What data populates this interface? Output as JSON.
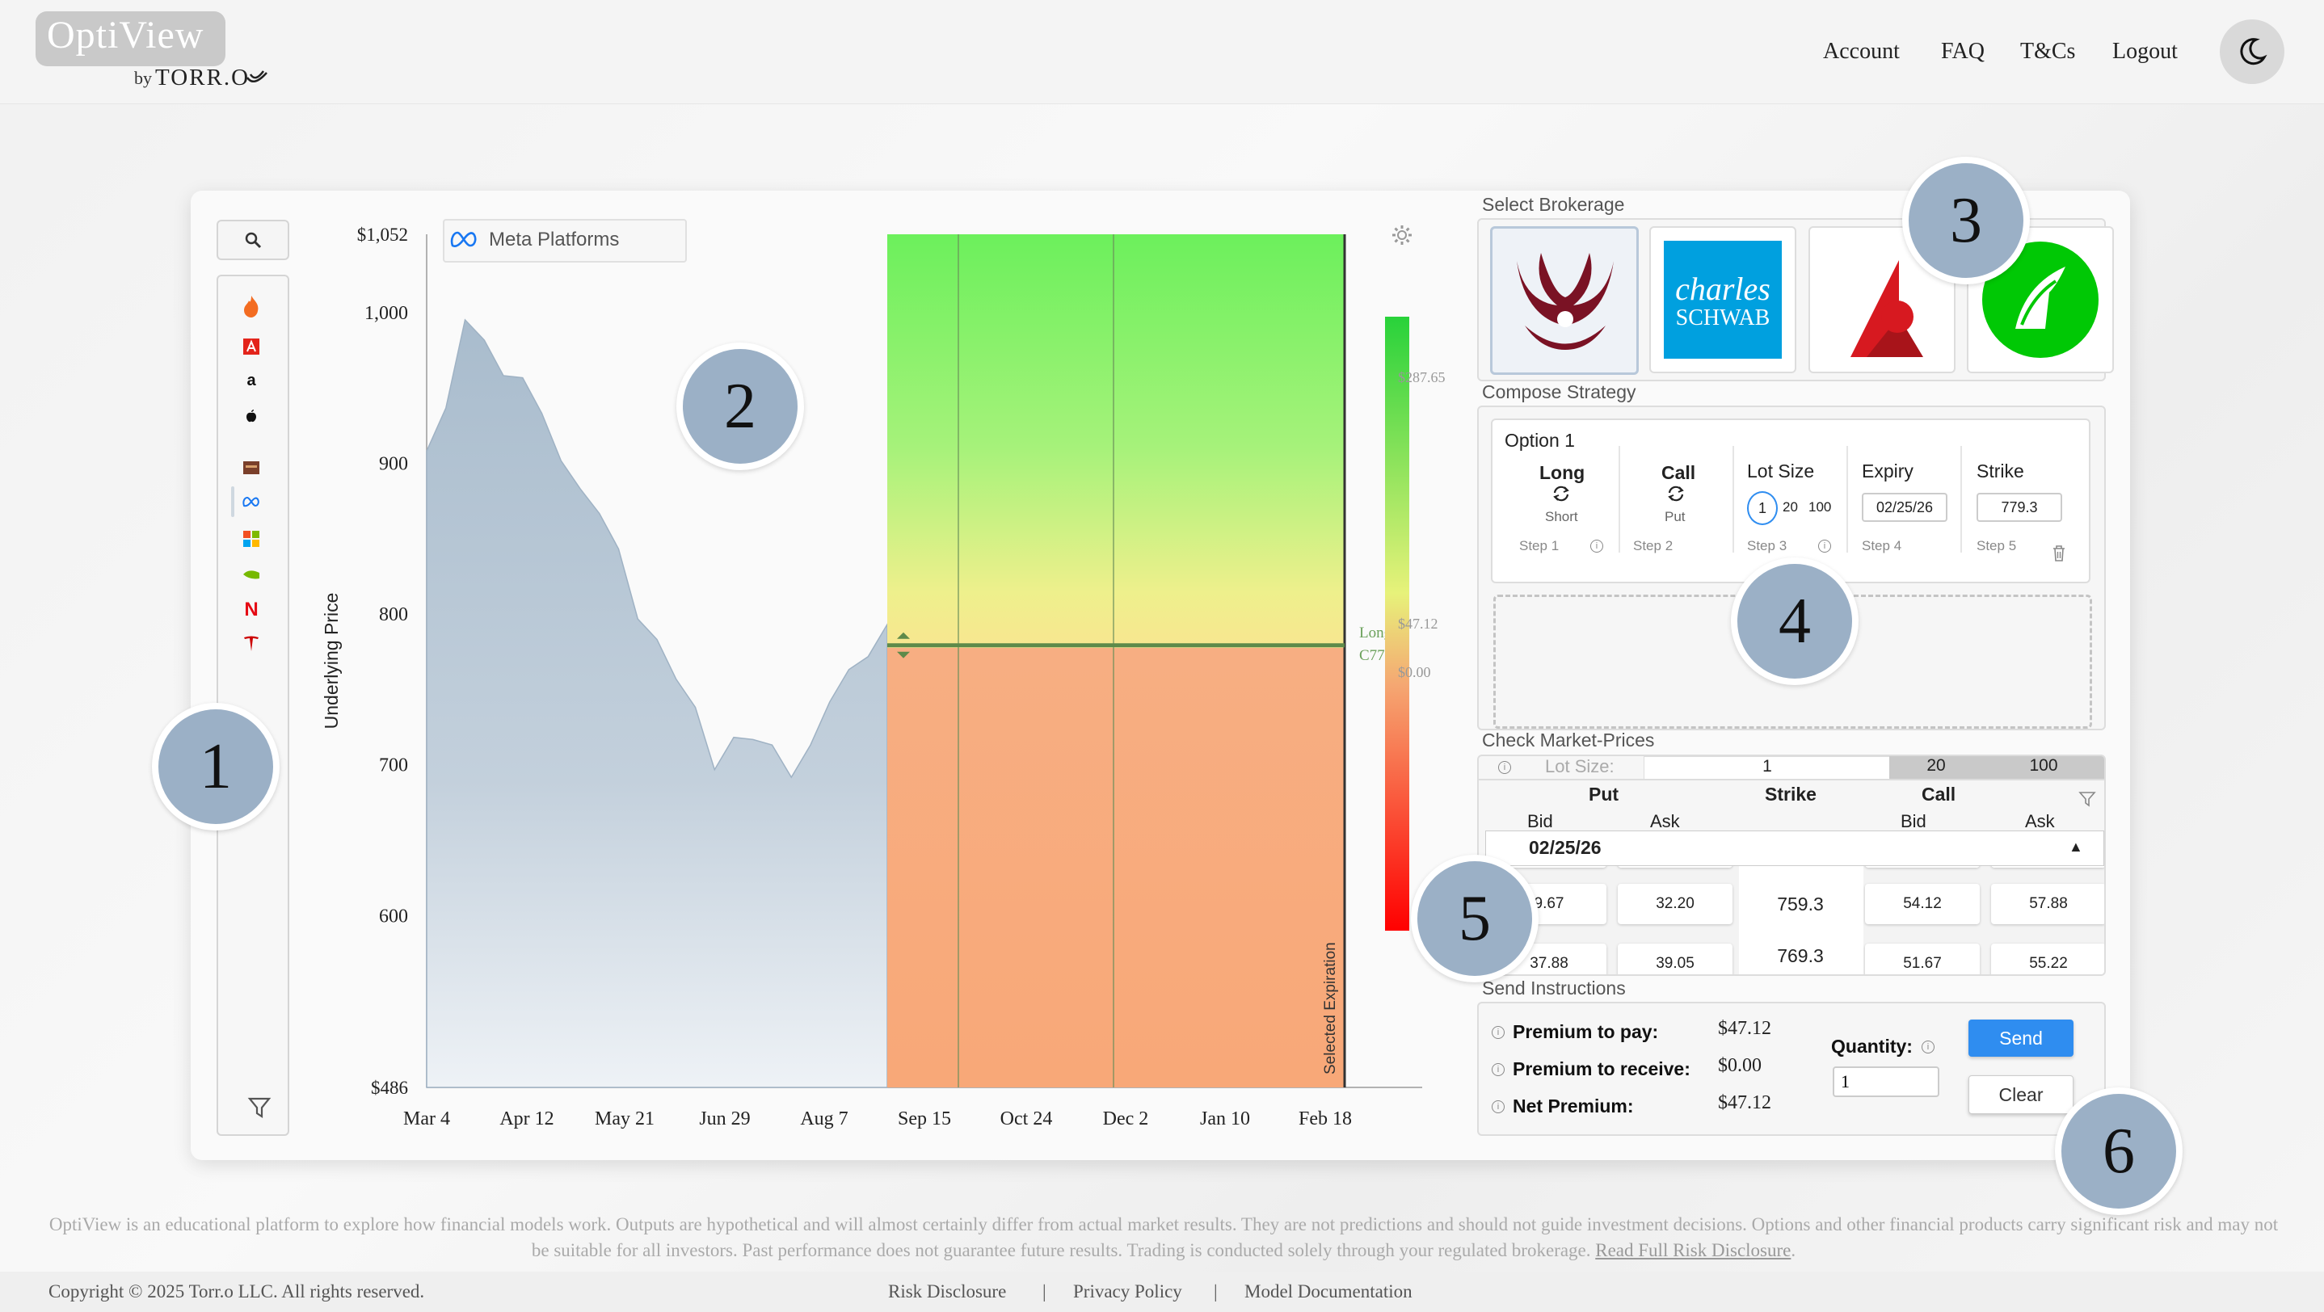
{
  "header": {
    "logo": "OptiView",
    "logo_by": "by",
    "logo_brand": "TORR.O",
    "nav": [
      "Account",
      "FAQ",
      "T&Cs",
      "Logout"
    ],
    "theme_icon": "moon-icon"
  },
  "chart": {
    "ticker": "Meta Platforms",
    "ylabel": "Underlying Price",
    "y_top_label": "$1,052",
    "y_bottom_label": "$486",
    "y_ticks": [
      "1,000",
      "900",
      "800",
      "700",
      "600"
    ],
    "x_ticks": [
      "Mar 4",
      "Apr 12",
      "May 21",
      "Jun 29",
      "Aug 7",
      "Sep 15",
      "Oct 24",
      "Dec 2",
      "Jan 10",
      "Feb 18"
    ],
    "expiration_label": "Selected Expiration",
    "strategy_label_1": "Long",
    "strategy_label_2": "C779.3",
    "scale_top": "$287.65",
    "scale_mid": "$47.12",
    "scale_zero": "$0.00"
  },
  "chart_data": {
    "type": "area",
    "title": "Meta Platforms",
    "xlabel": "",
    "ylabel": "Underlying Price",
    "ylim": [
      486,
      1052
    ],
    "x": [
      "Mar 4",
      "Mar 12",
      "Mar 20",
      "Mar 28",
      "Apr 5",
      "Apr 12",
      "Apr 20",
      "Apr 28",
      "May 6",
      "May 14",
      "May 21",
      "May 29",
      "Jun 6",
      "Jun 14",
      "Jun 22",
      "Jun 29",
      "Jul 7",
      "Jul 15",
      "Jul 23",
      "Jul 31",
      "Aug 7",
      "Aug 15",
      "Aug 23",
      "Aug 31",
      "Sep 8"
    ],
    "series": [
      {
        "values": [
          905,
          940,
          992,
          985,
          955,
          960,
          930,
          905,
          880,
          870,
          840,
          800,
          780,
          760,
          735,
          700,
          715,
          720,
          710,
          695,
          710,
          745,
          760,
          775,
          790
        ]
      }
    ],
    "strike": 779.3,
    "heatmap_range": [
      0,
      287.65
    ]
  },
  "brokerage": {
    "title": "Select Brokerage",
    "schwab_line1": "charles",
    "schwab_line2": "SCHWAB"
  },
  "strategy": {
    "title": "Compose Strategy",
    "option_title": "Option 1",
    "side": "Long",
    "side_alt": "Short",
    "type": "Call",
    "type_alt": "Put",
    "lot_label": "Lot Size",
    "lot_options": [
      "1",
      "20",
      "100"
    ],
    "expiry_label": "Expiry",
    "expiry_value": "02/25/26",
    "strike_label": "Strike",
    "strike_value": "779.3",
    "steps": [
      "Step 1",
      "Step 2",
      "Step 3",
      "Step 4",
      "Step 5"
    ]
  },
  "market": {
    "title": "Check Market-Prices",
    "lot_label": "Lot Size:",
    "lot_tabs": [
      "1",
      "20",
      "100"
    ],
    "put": "Put",
    "strike": "Strike",
    "call": "Call",
    "bid": "Bid",
    "ask": "Ask",
    "expiry_row": "02/25/26",
    "rows": [
      {
        "put_bid": "9.67",
        "put_ask": "32.20",
        "strike": "759.3",
        "call_bid": "54.12",
        "call_ask": "57.88"
      },
      {
        "put_bid": "37.88",
        "put_ask": "39.05",
        "strike": "769.3",
        "call_bid": "51.67",
        "call_ask": "55.22"
      }
    ]
  },
  "send": {
    "title": "Send Instructions",
    "pay_label": "Premium to pay:",
    "pay_value": "$47.12",
    "receive_label": "Premium to receive:",
    "receive_value": "$0.00",
    "net_label": "Net Premium:",
    "net_value": "$47.12",
    "qty_label": "Quantity:",
    "qty_value": "1",
    "send_label": "Send",
    "clear_label": "Clear"
  },
  "badges": [
    "1",
    "2",
    "3",
    "4",
    "5",
    "6"
  ],
  "disclaimer": {
    "text": "OptiView is an educational platform to explore how financial models work. Outputs are hypothetical and will almost certainly differ from actual market results. They are not predictions and should not guide investment decisions. Options and other financial products carry significant risk and may not be suitable for all investors. Past performance does not guarantee future results. Trading is conducted solely through your regulated brokerage.",
    "link": "Read Full Risk Disclosure"
  },
  "footer": {
    "copyright": "Copyright © 2025 Torr.o LLC. All rights reserved.",
    "links": [
      "Risk Disclosure",
      "Privacy Policy",
      "Model Documentation"
    ],
    "separator": "|"
  }
}
